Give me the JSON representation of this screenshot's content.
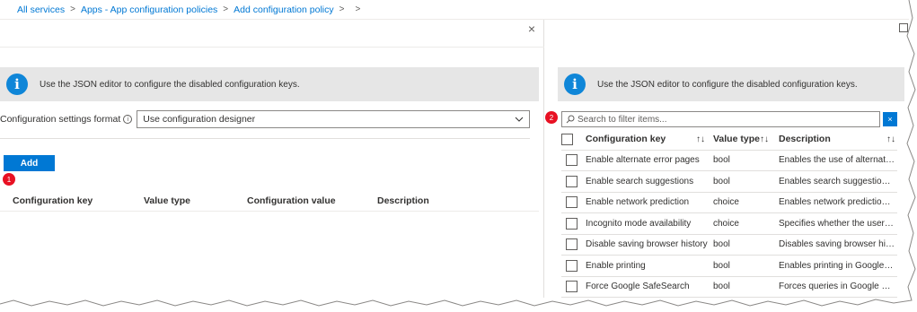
{
  "breadcrumb": {
    "items": [
      "All services",
      "Apps - App configuration policies",
      "Add configuration policy",
      ""
    ],
    "separator": ">"
  },
  "left_panel": {
    "close_glyph": "×",
    "info_banner": {
      "icon": "info-icon",
      "text": "Use the JSON editor to configure the disabled configuration keys."
    },
    "format": {
      "label": "Configuration settings format",
      "help_glyph": "i",
      "selected_value": "Use configuration designer"
    },
    "add_button_label": "Add",
    "badge_number": "1",
    "table_headers": [
      "Configuration key",
      "Value type",
      "Configuration value",
      "Description"
    ]
  },
  "right_panel": {
    "info_banner": {
      "icon": "info-icon",
      "text": "Use the JSON editor to configure the disabled configuration keys."
    },
    "badge_number": "2",
    "search": {
      "placeholder": "Search to filter items...",
      "clear_glyph": "×"
    },
    "table": {
      "headers": {
        "key": "Configuration key",
        "type": "Value type",
        "description": "Description",
        "sort_glyph": "↑↓"
      },
      "rows": [
        {
          "key": "Enable alternate error pages",
          "type": "bool",
          "description": "Enables the use of alternate er..."
        },
        {
          "key": "Enable search suggestions",
          "type": "bool",
          "description": "Enables search suggestions in ..."
        },
        {
          "key": "Enable network prediction",
          "type": "choice",
          "description": "Enables network prediction in ..."
        },
        {
          "key": "Incognito mode availability",
          "type": "choice",
          "description": "Specifies whether the user ma..."
        },
        {
          "key": "Disable saving browser history",
          "type": "bool",
          "description": "Disables saving browser histor..."
        },
        {
          "key": "Enable printing",
          "type": "bool",
          "description": "Enables printing in Google Chr..."
        },
        {
          "key": "Force Google SafeSearch",
          "type": "bool",
          "description": "Forces queries in Google Web ..."
        }
      ]
    }
  },
  "colors": {
    "accent": "#0078d4",
    "badge": "#e81123",
    "info_icon": "#0f86d8",
    "banner_bg": "#e6e6e6"
  }
}
